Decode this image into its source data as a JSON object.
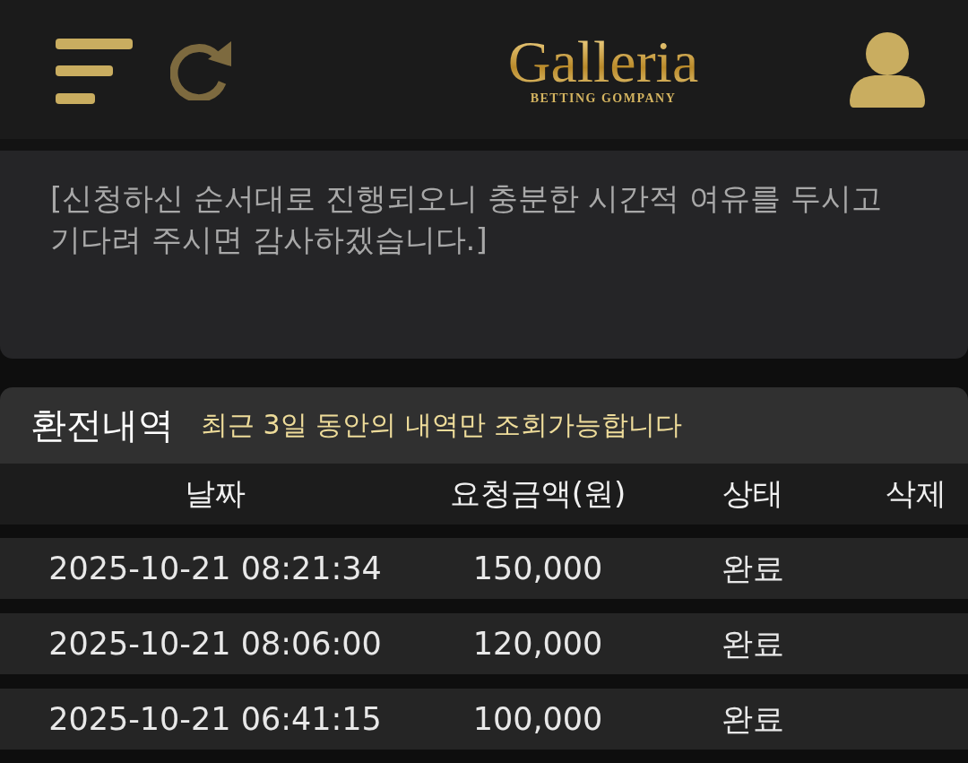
{
  "header": {
    "logo": "Galleria",
    "logo_subtitle": "BETTING GOMPANY"
  },
  "notice": {
    "text": "[신청하신 순서대로 진행되오니 충분한 시간적 여유를 두시고 기다려 주시면 감사하겠습니다.]"
  },
  "history": {
    "title": "환전내역",
    "note": "최근 3일 동안의 내역만 조회가능합니다",
    "columns": [
      "날짜",
      "요청금액(원)",
      "상태",
      "삭제"
    ],
    "rows": [
      {
        "date": "2025-10-21 08:21:34",
        "amount": "150,000",
        "status": "완료"
      },
      {
        "date": "2025-10-21 08:06:00",
        "amount": "120,000",
        "status": "완료"
      },
      {
        "date": "2025-10-21 06:41:15",
        "amount": "100,000",
        "status": "완료"
      }
    ]
  }
}
